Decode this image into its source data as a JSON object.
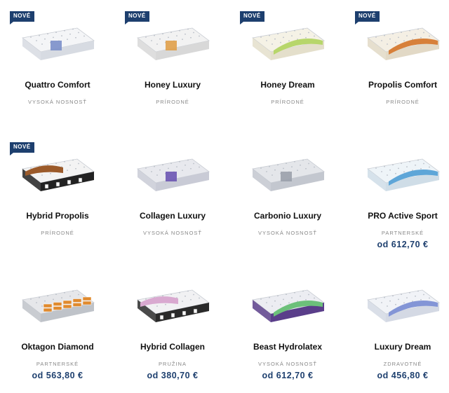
{
  "badge_label": "NOVÉ",
  "colors": {
    "accent": "#1d3f6e",
    "category_text": "#888888"
  },
  "products": [
    {
      "name": "Quattro Comfort",
      "category": "VYSOKÁ NOSNOSŤ",
      "price": "",
      "badge": true,
      "image": "mattress-white-blue-core"
    },
    {
      "name": "Honey Luxury",
      "category": "PRÍRODNÉ",
      "price": "",
      "badge": true,
      "image": "mattress-white-honey-core"
    },
    {
      "name": "Honey Dream",
      "category": "PRÍRODNÉ",
      "price": "",
      "badge": true,
      "image": "mattress-cream-green-layer"
    },
    {
      "name": "Propolis Comfort",
      "category": "PRÍRODNÉ",
      "price": "",
      "badge": true,
      "image": "mattress-cream-orange-layer"
    },
    {
      "name": "Hybrid Propolis",
      "category": "PRÍRODNÉ",
      "price": "",
      "badge": true,
      "image": "mattress-white-brown-springs"
    },
    {
      "name": "Collagen Luxury",
      "category": "VYSOKÁ NOSNOSŤ",
      "price": "",
      "badge": false,
      "image": "mattress-grey-purple-core"
    },
    {
      "name": "Carbonio Luxury",
      "category": "VYSOKÁ NOSNOSŤ",
      "price": "",
      "badge": false,
      "image": "mattress-grey-quilted"
    },
    {
      "name": "PRO Active Sport",
      "category": "PARTNERSKÉ",
      "price": "od 612,70 €",
      "badge": false,
      "image": "mattress-white-blue-wave"
    },
    {
      "name": "Oktagon Diamond",
      "category": "PARTNERSKÉ",
      "price": "od 563,80 €",
      "badge": false,
      "image": "mattress-grey-orange-cubes"
    },
    {
      "name": "Hybrid Collagen",
      "category": "PRUŽINA",
      "price": "od 380,70 €",
      "badge": false,
      "image": "mattress-white-pink-springs"
    },
    {
      "name": "Beast Hydrolatex",
      "category": "VYSOKÁ NOSNOSŤ",
      "price": "od 612,70 €",
      "badge": false,
      "image": "mattress-grey-green-layer"
    },
    {
      "name": "Luxury Dream",
      "category": "ZDRAVOTNÉ",
      "price": "od 456,80 €",
      "badge": false,
      "image": "mattress-white-blue-layer"
    }
  ]
}
